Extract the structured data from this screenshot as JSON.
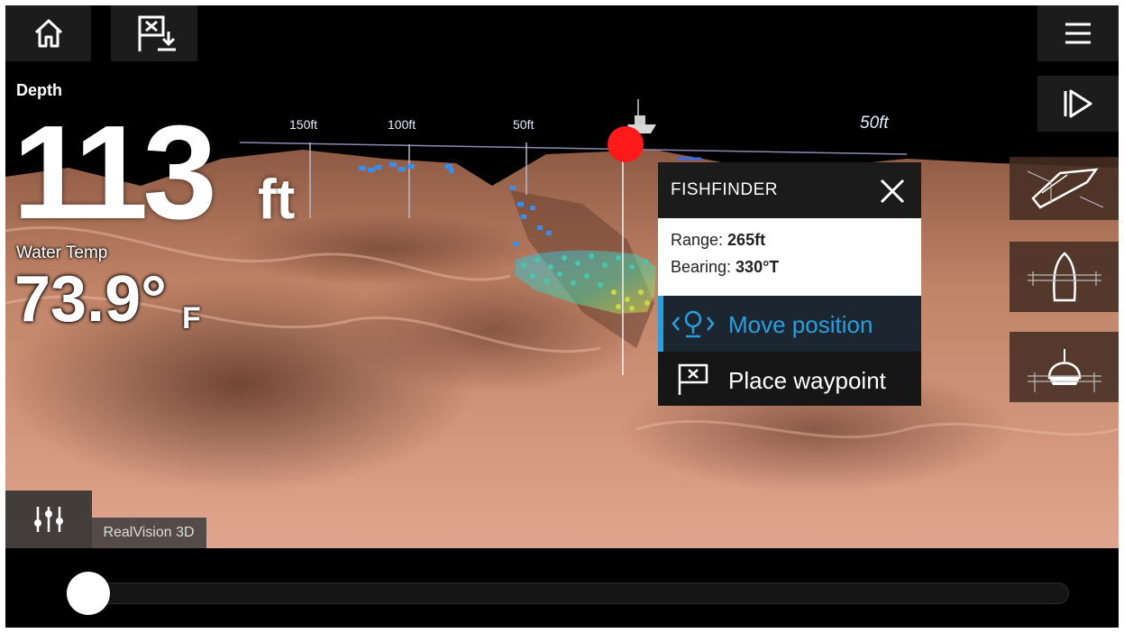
{
  "depth": {
    "label": "Depth",
    "value": "113",
    "unit": "ft"
  },
  "water_temp": {
    "label": "Water Temp",
    "value": "73.9°",
    "unit": "F"
  },
  "range_scale": [
    "150ft",
    "100ft",
    "50ft"
  ],
  "range_scale_right": "50ft",
  "popup": {
    "title": "FISHFINDER",
    "range_label": "Range: ",
    "range_value": "265ft",
    "bearing_label": "Bearing: ",
    "bearing_value": "330°T",
    "move_position": "Move position",
    "place_waypoint": "Place waypoint"
  },
  "mode_label": "RealVision 3D",
  "slider_position": 0.0,
  "colors": {
    "accent": "#2a9fe0",
    "cursor": "#ff1a1a",
    "seabed": "#c98a6e"
  },
  "icons": {
    "home": "home-icon",
    "waypoint": "waypoint-flag-icon",
    "menu": "hamburger-menu-icon",
    "play": "play-icon",
    "view_iso": "boat-isometric-view-icon",
    "view_top": "boat-top-view-icon",
    "view_front": "boat-front-view-icon",
    "settings": "sliders-icon"
  }
}
